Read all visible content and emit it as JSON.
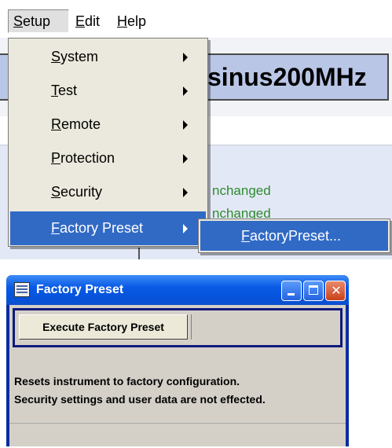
{
  "menubar": {
    "items": [
      {
        "label": "Setup"
      },
      {
        "label": "Edit"
      },
      {
        "label": "Help"
      }
    ]
  },
  "setup_menu": {
    "items": [
      {
        "label": "System",
        "submenu": true
      },
      {
        "label": "Test",
        "submenu": true
      },
      {
        "label": "Remote",
        "submenu": true
      },
      {
        "label": "Protection",
        "submenu": true
      },
      {
        "label": "Security",
        "submenu": true
      },
      {
        "label": "Factory Preset",
        "submenu": true,
        "selected": true
      }
    ],
    "submenu": {
      "items": [
        {
          "label": "FactoryPreset..."
        }
      ]
    }
  },
  "background": {
    "title": "sinus200MHz",
    "status_lines": [
      "nchanged",
      "nchanged",
      "     "
    ]
  },
  "dialog": {
    "title": "Factory Preset",
    "execute_button": "Execute Factory Preset",
    "description_line1": "Resets instrument to factory configuration.",
    "description_line2": "Security settings and user data are not effected."
  },
  "colors": {
    "menu_highlight": "#316ac5",
    "menu_bg": "#ebe9dd",
    "title_box_bg": "#bac6e6",
    "status_text": "#2e8b2e",
    "titlebar_blue": "#0a5ae6",
    "close_button": "#c9411a",
    "dialog_face": "#d4d0c8"
  },
  "icons": {
    "submenu_arrow": "triangle-right-icon",
    "window_icon": "dialog-window-icon",
    "minimize": "minimize-icon",
    "maximize": "maximize-icon",
    "close": "close-icon"
  }
}
